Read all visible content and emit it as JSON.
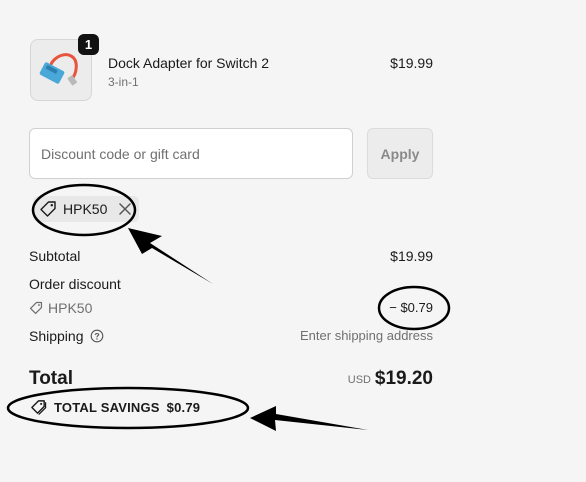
{
  "cart": {
    "item": {
      "quantity": "1",
      "name": "Dock Adapter for Switch 2",
      "variant": "3-in-1",
      "price": "$19.99",
      "image_icon": "dock-adapter-image"
    }
  },
  "discount": {
    "placeholder": "Discount code or gift card",
    "apply_label": "Apply",
    "applied_code": "HPK50"
  },
  "summary": {
    "subtotal_label": "Subtotal",
    "subtotal_value": "$19.99",
    "order_discount_label": "Order discount",
    "discount_code": "HPK50",
    "discount_value": "− $0.79",
    "shipping_label": "Shipping",
    "shipping_value": "Enter shipping address",
    "total_label": "Total",
    "currency": "USD",
    "total_value": "$19.20",
    "savings_label": "TOTAL SAVINGS",
    "savings_value": "$0.79"
  },
  "colors": {
    "background": "#f5f5f5",
    "annotation": "#000000"
  }
}
